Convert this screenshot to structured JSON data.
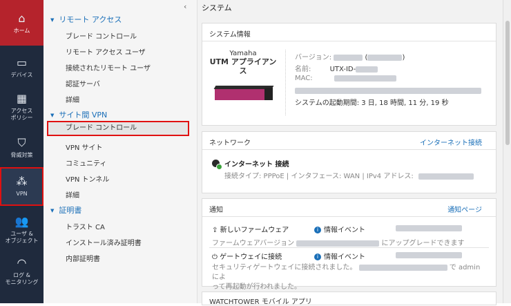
{
  "rail": {
    "home": "ホーム",
    "devices": "デバイス",
    "access_1": "アクセス",
    "access_2": "ポリシー",
    "threat": "脅威対策",
    "vpn": "VPN",
    "users_1": "ユーザ &",
    "users_2": "オブジェクト",
    "logs_1": "ログ &",
    "logs_2": "モニタリング"
  },
  "nav": {
    "remote_access": {
      "label": "リモート アクセス",
      "items": [
        "ブレード コントロール",
        "リモート アクセス ユーザ",
        "接続されたリモート ユーザ",
        "認証サーバ",
        "詳細"
      ]
    },
    "site_vpn": {
      "label": "サイト間 VPN",
      "items": [
        "ブレード コントロール",
        "VPN サイト",
        "コミュニティ",
        "VPN トンネル",
        "詳細"
      ]
    },
    "certs": {
      "label": "証明書",
      "items": [
        "トラスト CA",
        "インストール済み証明書",
        "内部証明書"
      ]
    }
  },
  "main": {
    "title": "システム",
    "sysinfo": {
      "header": "システム情報",
      "brand": "Yamaha",
      "product": "UTM アプライアンス",
      "version_label": "バージョン:",
      "name_label": "名前:",
      "name_prefix": "UTX-ID-",
      "mac_label": "MAC:",
      "uptime": "システムの起動期間: 3 日, 18 時間, 11 分, 19 秒"
    },
    "network": {
      "header": "ネットワーク",
      "link": "インターネット接続",
      "conn_title": "インターネット 接続",
      "conn_detail": "接続タイプ: PPPoE | インタフェース: WAN | IPv4 アドレス:"
    },
    "notify": {
      "header": "通知",
      "link": "通知ページ",
      "n1_title": "新しいファームウェア",
      "n1_type": "情報イベント",
      "n1_detail_a": "ファームウェアバージョン",
      "n1_detail_b": "にアップグレードできます",
      "n2_title": "ゲートウェイに接続",
      "n2_type": "情報イベント",
      "n2_detail_a": "セキュリティゲートウェイに接続されました。",
      "n2_detail_b": "で admin によ",
      "n2_detail_c": "って再起動が行われました。"
    },
    "watchtower": {
      "header": "WATCHTOWER モバイル アプリ"
    }
  }
}
